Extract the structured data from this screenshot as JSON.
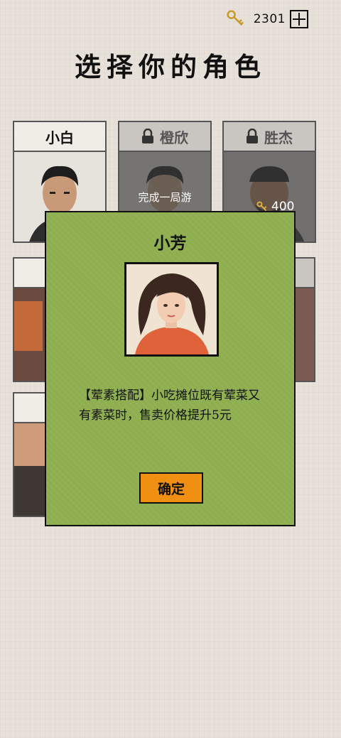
{
  "header": {
    "currency_icon": "key-icon",
    "currency_amount": "2301",
    "add_icon": "plus-box-icon"
  },
  "page_title": "选择你的角色",
  "characters": [
    {
      "name": "小白",
      "locked": false
    },
    {
      "name": "橙欣",
      "locked": true,
      "unlock_condition": "完成一局游"
    },
    {
      "name": "胜杰",
      "locked": true,
      "price": "400"
    }
  ],
  "dialog": {
    "title": "小芳",
    "description": "【荤素搭配】小吃摊位既有荤菜又有素菜时，售卖价格提升5元",
    "confirm_label": "确定"
  },
  "colors": {
    "dialog_bg": "#8fae4f",
    "confirm_bg": "#f09012",
    "page_bg": "#e7e1d9"
  }
}
